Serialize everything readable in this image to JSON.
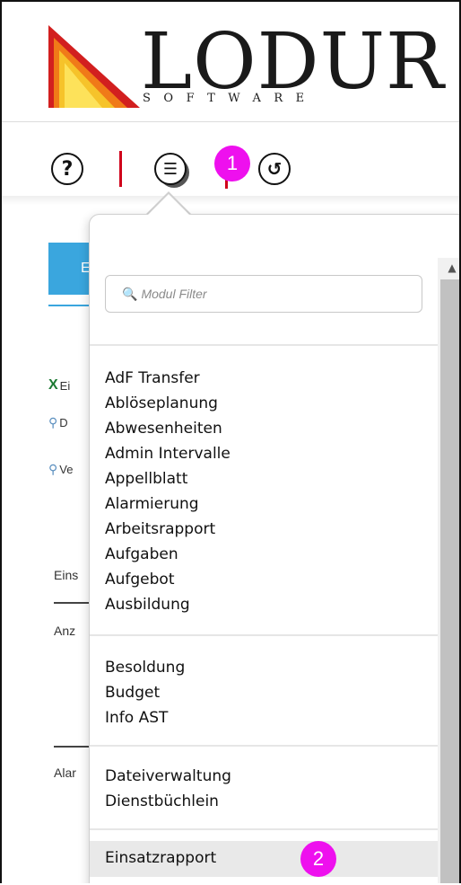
{
  "logo": {
    "word": "LODUR",
    "sub": "SOFTWARE"
  },
  "toolbar": {
    "help_glyph": "?",
    "menu_glyph": "☰",
    "undo_glyph": "↺",
    "badge_1": "1",
    "badge_2": "2"
  },
  "colors": {
    "accent": "#3aa6de",
    "badge": "#ee10ee",
    "divider": "#d0021b"
  },
  "background": {
    "tab_label": "E",
    "links": [
      {
        "icon": "excel-icon",
        "text": "Ei"
      },
      {
        "icon": "magnifier-icon",
        "text": "D"
      },
      {
        "icon": "magnifier-icon",
        "text": "Ve"
      }
    ],
    "texts": [
      "Eins",
      "Anz",
      "Alar"
    ]
  },
  "menu": {
    "filter_placeholder": "Modul Filter",
    "group1": [
      "AdF Transfer",
      "Ablöseplanung",
      "Abwesenheiten",
      "Admin Intervalle",
      "Appellblatt",
      "Alarmierung",
      "Arbeitsrapport",
      "Aufgaben",
      "Aufgebot",
      "Ausbildung"
    ],
    "group2": [
      "Besoldung",
      "Budget",
      "Info AST"
    ],
    "group3": [
      "Dateiverwaltung",
      "Dienstbüchlein"
    ],
    "highlighted": "Einsatzrapport"
  }
}
